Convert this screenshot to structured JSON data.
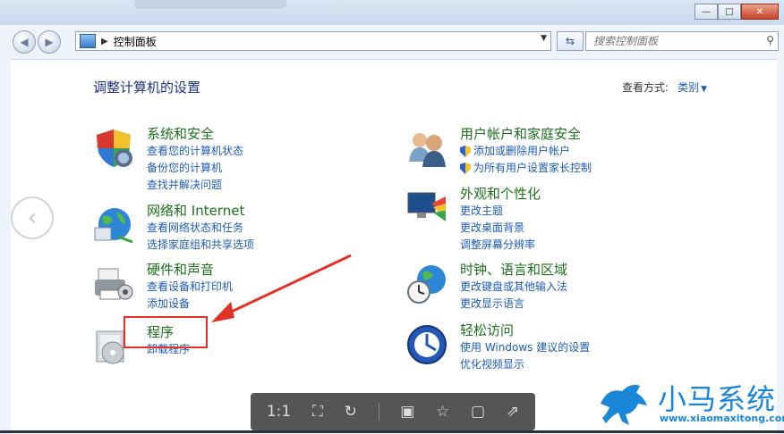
{
  "address": {
    "crumb": "控制面板"
  },
  "search": {
    "placeholder": "搜索控制面板"
  },
  "header": {
    "title": "调整计算机的设置",
    "view_by_label": "查看方式:",
    "view_by_value": "类别"
  },
  "categories": {
    "system": {
      "title": "系统和安全",
      "links": [
        "查看您的计算机状态",
        "备份您的计算机",
        "查找并解决问题"
      ]
    },
    "network": {
      "title": "网络和 Internet",
      "links": [
        "查看网络状态和任务",
        "选择家庭组和共享选项"
      ]
    },
    "hardware": {
      "title": "硬件和声音",
      "links": [
        "查看设备和打印机",
        "添加设备"
      ]
    },
    "programs": {
      "title": "程序",
      "links": [
        "卸载程序"
      ]
    },
    "accounts": {
      "title": "用户帐户和家庭安全",
      "links": [
        "添加或删除用户帐户",
        "为所有用户设置家长控制"
      ]
    },
    "appearance": {
      "title": "外观和个性化",
      "links": [
        "更改主题",
        "更改桌面背景",
        "调整屏幕分辨率"
      ]
    },
    "clock": {
      "title": "时钟、语言和区域",
      "links": [
        "更改键盘或其他输入法",
        "更改显示语言"
      ]
    },
    "ease": {
      "title": "轻松访问",
      "links": [
        "使用 Windows 建议的设置",
        "优化视频显示"
      ]
    }
  },
  "viewer": {
    "ratio": "1:1"
  },
  "watermark": {
    "name": "小马系统",
    "url": "www.xiaomaxitong.com"
  },
  "colors": {
    "highlight_box": "#e23228",
    "link": "#1e5bb5",
    "category_title": "#1d6f1d"
  }
}
